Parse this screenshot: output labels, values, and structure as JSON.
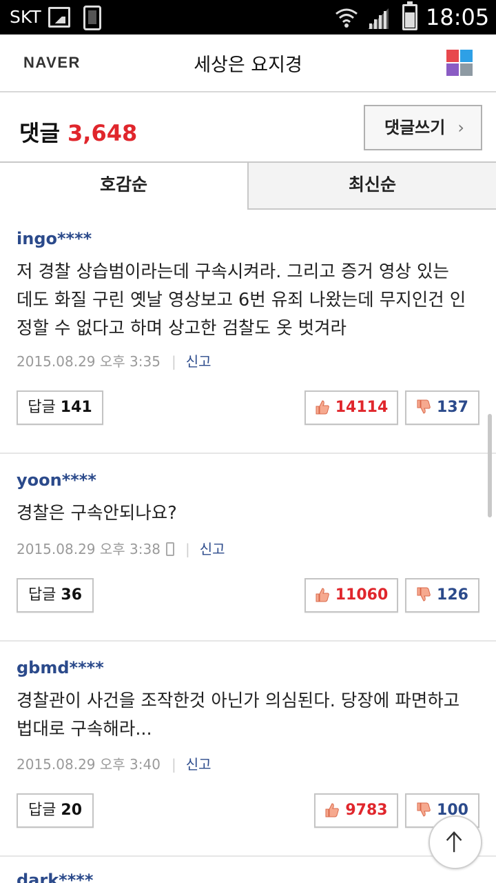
{
  "status_bar": {
    "carrier": "SKT",
    "time": "18:05",
    "icons": [
      "image-icon",
      "phone-icon",
      "wifi-icon",
      "signal-icon",
      "battery-icon"
    ]
  },
  "header": {
    "logo": "NAVER",
    "title": "세상은 요지경",
    "menu_icon": "app-grid-icon",
    "menu_colors": [
      "#e8484d",
      "#2ea0e6",
      "#8a5cc4",
      "#8e9aa3"
    ]
  },
  "comments_header": {
    "label": "댓글",
    "count": "3,648",
    "write_label": "댓글쓰기",
    "write_chevron": "›"
  },
  "tabs": [
    {
      "label": "호감순",
      "active": true
    },
    {
      "label": "최신순",
      "active": false
    }
  ],
  "comments": [
    {
      "user": "ingo****",
      "text_lines": [
        "저 경찰 상습범이라는데 구속시켜라. 그리고 증거 영상 있는",
        "데도 화질 구린 옛날 영상보고 6번 유죄 나왔는데 무지인건 인",
        "정할 수 없다고 하며 상고한 검찰도 옷 벗겨라"
      ],
      "date": "2015.08.29 오후 3:35",
      "mobile": false,
      "report": "신고",
      "reply_label": "답글",
      "reply_count": "141",
      "likes": "14114",
      "dislikes": "137"
    },
    {
      "user": "yoon****",
      "text_lines": [
        "경찰은 구속안되나요?"
      ],
      "date": "2015.08.29 오후 3:38",
      "mobile": true,
      "report": "신고",
      "reply_label": "답글",
      "reply_count": "36",
      "likes": "11060",
      "dislikes": "126"
    },
    {
      "user": "gbmd****",
      "text_lines": [
        "경찰관이 사건을 조작한것 아닌가 의심된다. 당장에 파면하고",
        "법대로 구속해라..."
      ],
      "date": "2015.08.29 오후 3:40",
      "mobile": false,
      "report": "신고",
      "reply_label": "답글",
      "reply_count": "20",
      "likes": "9783",
      "dislikes": "100"
    }
  ],
  "next_user": "dark****",
  "colors": {
    "accent_red": "#e0262c",
    "user_blue": "#2b4a8b"
  }
}
